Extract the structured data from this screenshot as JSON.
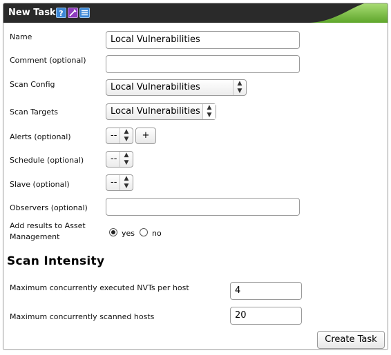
{
  "window": {
    "title": "New Task",
    "icons": [
      "help-icon",
      "wizard-icon",
      "list-icon"
    ]
  },
  "form": {
    "name": {
      "label": "Name",
      "value": "Local Vulnerabilities"
    },
    "comment": {
      "label": "Comment (optional)",
      "value": ""
    },
    "scan_config": {
      "label": "Scan Config",
      "selected": "Local Vulnerabilities"
    },
    "scan_targets": {
      "label": "Scan Targets",
      "selected": "Local Vulnerabilities"
    },
    "alerts": {
      "label": "Alerts (optional)",
      "selected": "--",
      "add_label": "+"
    },
    "schedule": {
      "label": "Schedule (optional)",
      "selected": "--"
    },
    "slave": {
      "label": "Slave (optional)",
      "selected": "--"
    },
    "observers": {
      "label": "Observers (optional)",
      "value": ""
    },
    "asset_mgmt": {
      "label_line1": "Add results to Asset",
      "label_line2": "Management",
      "yes_label": "yes",
      "no_label": "no",
      "selected": "yes"
    }
  },
  "intensity": {
    "heading": "Scan Intensity",
    "max_nvts": {
      "label": "Maximum concurrently executed NVTs per host",
      "value": "4"
    },
    "max_hosts": {
      "label": "Maximum concurrently scanned hosts",
      "value": "20"
    }
  },
  "actions": {
    "create_label": "Create Task"
  },
  "colors": {
    "titlebar": "#2a2a2a",
    "accent_green": "#7bc043"
  }
}
